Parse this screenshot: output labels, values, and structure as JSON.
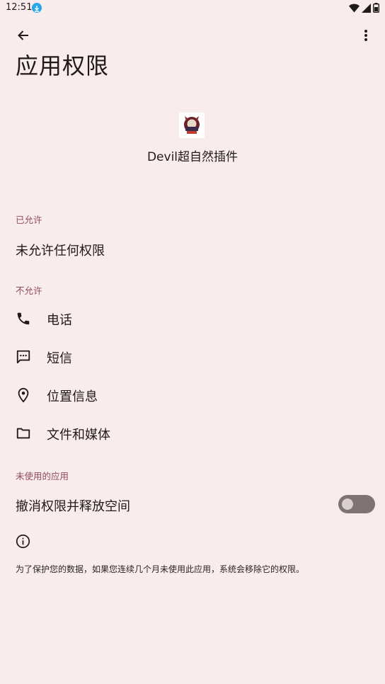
{
  "status_bar": {
    "time": "12:51",
    "icons": [
      "download-badge-icon",
      "wifi-icon",
      "cell-signal-icon",
      "battery-icon"
    ],
    "accent": "#27a6e8"
  },
  "toolbar": {
    "back_icon": "arrow-left-icon",
    "more_icon": "more-vert-icon"
  },
  "page": {
    "title": "应用权限"
  },
  "app": {
    "name": "Devil超自然插件"
  },
  "allowed": {
    "header": "已允许",
    "empty_text": "未允许任何权限"
  },
  "denied": {
    "header": "不允许",
    "items": [
      {
        "label": "电话",
        "icon": "phone-icon"
      },
      {
        "label": "短信",
        "icon": "sms-icon"
      },
      {
        "label": "位置信息",
        "icon": "location-icon"
      },
      {
        "label": "文件和媒体",
        "icon": "folder-icon"
      }
    ]
  },
  "unused": {
    "header": "未使用的应用",
    "toggle_label": "撤消权限并释放空间",
    "toggle_on": false,
    "note": "为了保护您的数据，如果您连续几个月未使用此应用，系统会移除它的权限。"
  },
  "colors": {
    "background": "#f9ecec",
    "section_header": "#8d4a5a",
    "toggle_track": "#7f7375"
  }
}
